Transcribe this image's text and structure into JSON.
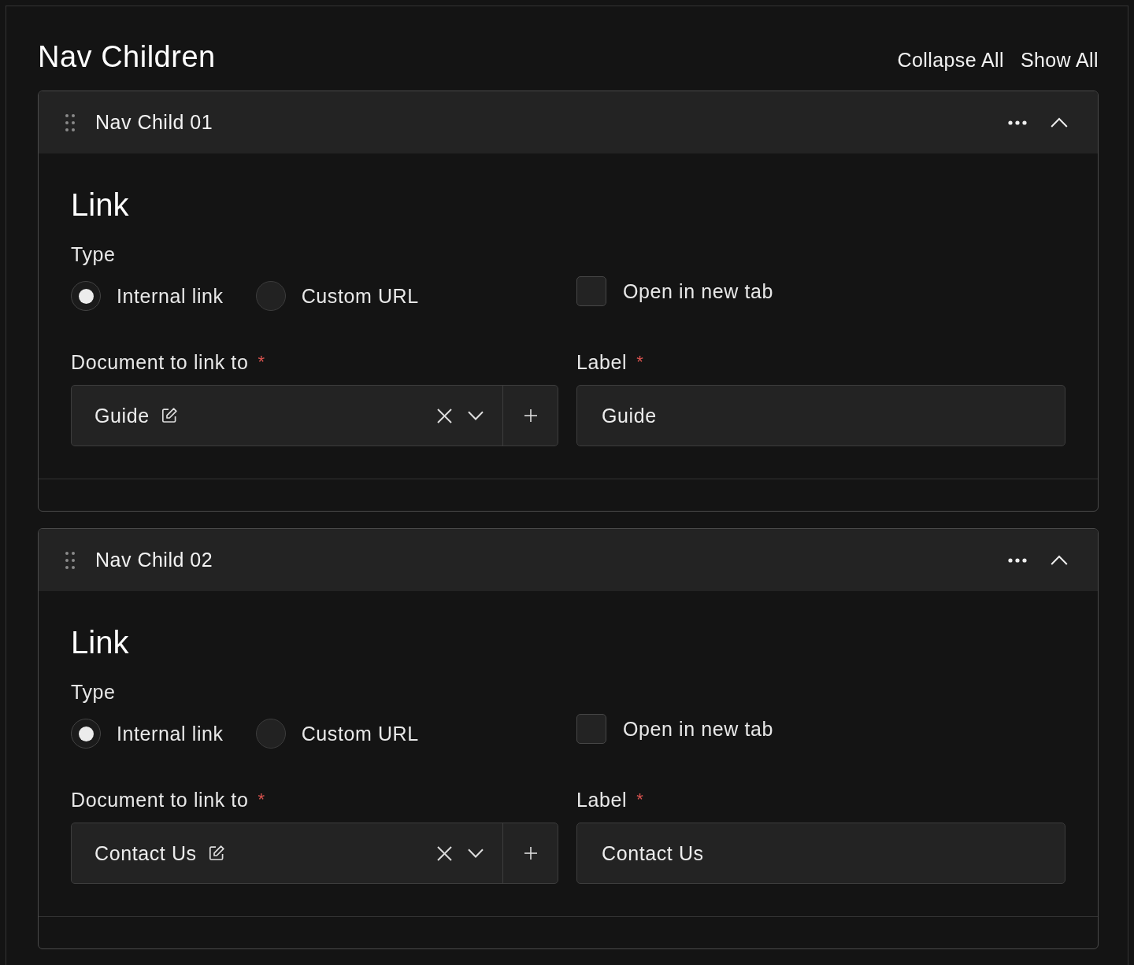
{
  "header": {
    "title": "Nav Children",
    "collapse_all": "Collapse All",
    "show_all": "Show All"
  },
  "items": [
    {
      "title": "Nav Child 01",
      "expanded": true,
      "section_title": "Link",
      "type": {
        "label": "Type",
        "options": [
          {
            "label": "Internal link",
            "selected": true
          },
          {
            "label": "Custom URL",
            "selected": false
          }
        ]
      },
      "new_tab": {
        "label": "Open in new tab",
        "checked": false
      },
      "document": {
        "label": "Document to link to",
        "required_mark": "*",
        "value": "Guide"
      },
      "link_label": {
        "label": "Label",
        "required_mark": "*",
        "value": "Guide"
      }
    },
    {
      "title": "Nav Child 02",
      "expanded": true,
      "section_title": "Link",
      "type": {
        "label": "Type",
        "options": [
          {
            "label": "Internal link",
            "selected": true
          },
          {
            "label": "Custom URL",
            "selected": false
          }
        ]
      },
      "new_tab": {
        "label": "Open in new tab",
        "checked": false
      },
      "document": {
        "label": "Document to link to",
        "required_mark": "*",
        "value": "Contact Us"
      },
      "link_label": {
        "label": "Label",
        "required_mark": "*",
        "value": "Contact Us"
      }
    }
  ]
}
